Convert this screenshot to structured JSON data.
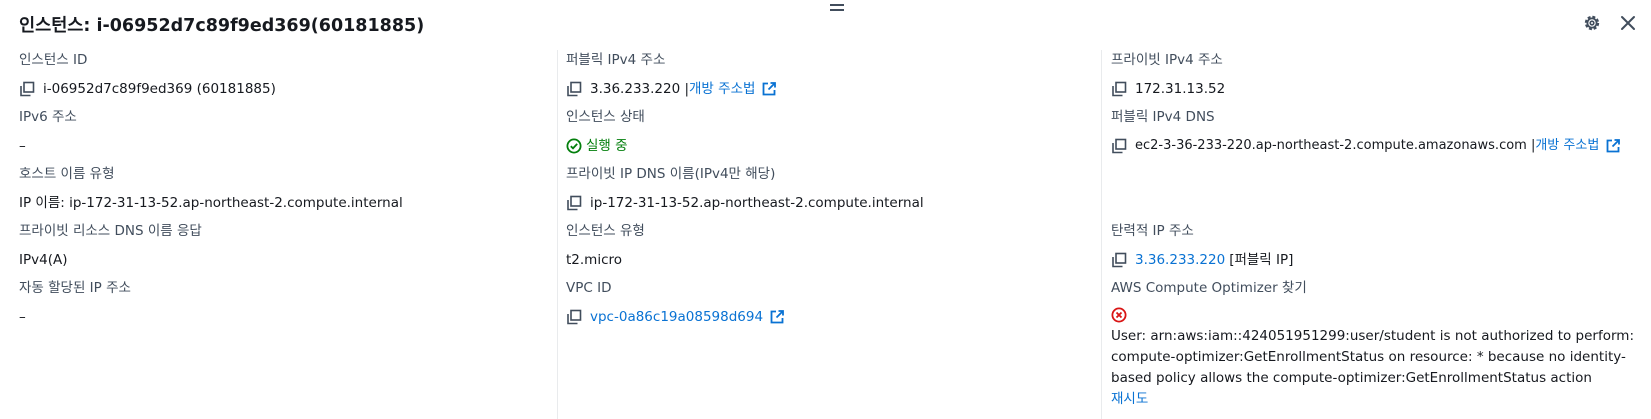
{
  "header": {
    "title": "인스턴스: i-06952d7c89f9ed369(60181885)"
  },
  "col1": {
    "instance_id": {
      "label": "인스턴스 ID",
      "value": "i-06952d7c89f9ed369 (60181885)"
    },
    "ipv6": {
      "label": "IPv6 주소",
      "value": "–"
    },
    "hostname_type": {
      "label": "호스트 이름 유형",
      "value": "IP 이름: ip-172-31-13-52.ap-northeast-2.compute.internal"
    },
    "private_dns_answer": {
      "label": "프라이빗 리소스 DNS 이름 응답",
      "value": "IPv4(A)"
    },
    "auto_ip": {
      "label": "자동 할당된 IP 주소",
      "value": "–"
    }
  },
  "col2": {
    "public_ipv4": {
      "label": "퍼블릭 IPv4 주소",
      "value": "3.36.233.220 |",
      "link": "개방 주소법"
    },
    "instance_state": {
      "label": "인스턴스 상태",
      "value": "실행 중"
    },
    "private_ip_dns": {
      "label": "프라이빗 IP DNS 이름(IPv4만 해당)",
      "value": "ip-172-31-13-52.ap-northeast-2.compute.internal"
    },
    "instance_type": {
      "label": "인스턴스 유형",
      "value": "t2.micro"
    },
    "vpc_id": {
      "label": "VPC ID",
      "value": "vpc-0a86c19a08598d694"
    }
  },
  "col3": {
    "private_ipv4": {
      "label": "프라이빗 IPv4 주소",
      "value": "172.31.13.52"
    },
    "public_dns": {
      "label": "퍼블릭 IPv4 DNS",
      "value": "ec2-3-36-233-220.ap-northeast-2.compute.amazonaws.com |",
      "link": "개방 주소법"
    },
    "elastic_ip": {
      "label": "탄력적 IP 주소",
      "value_link": "3.36.233.220",
      "value_suffix": "[퍼블릭 IP]"
    },
    "optimizer": {
      "label": "AWS Compute Optimizer 찾기",
      "error": "User: arn:aws:iam::424051951299:user/student is not authorized to perform: compute-optimizer:GetEnrollmentStatus on resource: * because no identity-based policy allows the compute-optimizer:GetEnrollmentStatus action",
      "retry": "재시도"
    }
  },
  "colors": {
    "link": "#0972d3",
    "success": "#037f0c",
    "error": "#d91515",
    "text": "#16191f",
    "label": "#414d5c"
  },
  "icons": {
    "copy": "copy-icon",
    "external": "external-link-icon",
    "status_ok": "check-circle-icon",
    "error": "x-circle-icon",
    "settings": "gear-icon",
    "close": "close-icon",
    "drag": "drag-handle-icon"
  }
}
